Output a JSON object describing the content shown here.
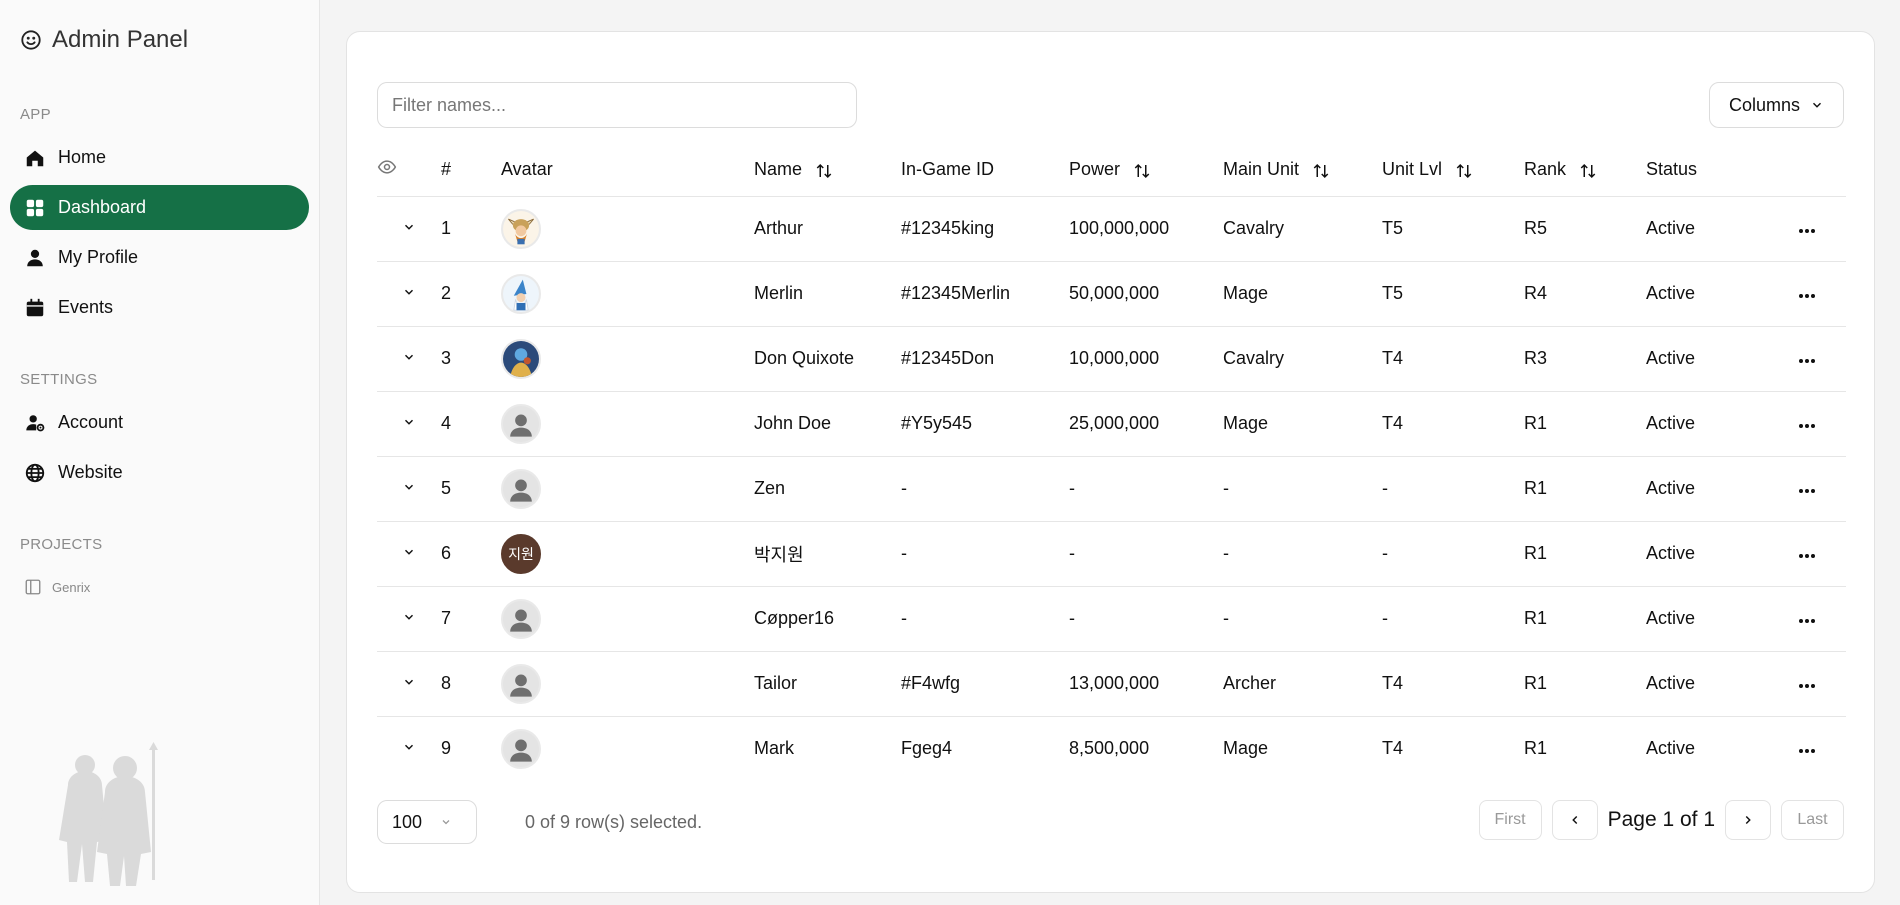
{
  "app": {
    "title": "Admin Panel"
  },
  "sidebar": {
    "sections": [
      {
        "label": "APP"
      },
      {
        "label": "SETTINGS"
      },
      {
        "label": "PROJECTS"
      }
    ],
    "items": [
      {
        "label": "Home",
        "icon": "home-icon"
      },
      {
        "label": "Dashboard",
        "icon": "dashboard-icon",
        "active": true
      },
      {
        "label": "My Profile",
        "icon": "user-icon"
      },
      {
        "label": "Events",
        "icon": "calendar-icon"
      },
      {
        "label": "Account",
        "icon": "user-gear-icon"
      },
      {
        "label": "Website",
        "icon": "globe-icon"
      }
    ],
    "projects": [
      {
        "label": "Genrix",
        "icon": "panel-icon"
      }
    ]
  },
  "toolbar": {
    "filter_placeholder": "Filter names...",
    "columns_label": "Columns"
  },
  "table": {
    "headers": {
      "num": "#",
      "avatar": "Avatar",
      "name": "Name",
      "ingame_id": "In-Game ID",
      "power": "Power",
      "main_unit": "Main Unit",
      "unit_lvl": "Unit Lvl",
      "rank": "Rank",
      "status": "Status"
    },
    "rows": [
      {
        "num": "1",
        "avatar": "viking-avatar",
        "name": "Arthur",
        "ingame_id": "#12345king",
        "power": "100,000,000",
        "main_unit": "Cavalry",
        "unit_lvl": "T5",
        "rank": "R5",
        "status": "Active"
      },
      {
        "num": "2",
        "avatar": "wizard-avatar",
        "name": "Merlin",
        "ingame_id": "#12345Merlin",
        "power": "50,000,000",
        "main_unit": "Mage",
        "unit_lvl": "T5",
        "rank": "R4",
        "status": "Active"
      },
      {
        "num": "3",
        "avatar": "knight-avatar",
        "name": "Don Quixote",
        "ingame_id": "#12345Don",
        "power": "10,000,000",
        "main_unit": "Cavalry",
        "unit_lvl": "T4",
        "rank": "R3",
        "status": "Active"
      },
      {
        "num": "4",
        "avatar": "default-avatar",
        "name": "John Doe",
        "ingame_id": "#Y5y545",
        "power": "25,000,000",
        "main_unit": "Mage",
        "unit_lvl": "T4",
        "rank": "R1",
        "status": "Active"
      },
      {
        "num": "5",
        "avatar": "default-avatar",
        "name": "Zen",
        "ingame_id": "-",
        "power": "-",
        "main_unit": "-",
        "unit_lvl": "-",
        "rank": "R1",
        "status": "Active"
      },
      {
        "num": "6",
        "avatar": "initials-avatar",
        "avatar_text": "지원",
        "name": "박지원",
        "ingame_id": "-",
        "power": "-",
        "main_unit": "-",
        "unit_lvl": "-",
        "rank": "R1",
        "status": "Active"
      },
      {
        "num": "7",
        "avatar": "default-avatar",
        "name": "Cøpper16",
        "ingame_id": "-",
        "power": "-",
        "main_unit": "-",
        "unit_lvl": "-",
        "rank": "R1",
        "status": "Active"
      },
      {
        "num": "8",
        "avatar": "default-avatar",
        "name": "Tailor",
        "ingame_id": "#F4wfg",
        "power": "13,000,000",
        "main_unit": "Archer",
        "unit_lvl": "T4",
        "rank": "R1",
        "status": "Active"
      },
      {
        "num": "9",
        "avatar": "default-avatar",
        "name": "Mark",
        "ingame_id": "Fgeg4",
        "power": "8,500,000",
        "main_unit": "Mage",
        "unit_lvl": "T4",
        "rank": "R1",
        "status": "Active"
      }
    ]
  },
  "footer": {
    "page_size": "100",
    "selection": "0 of 9 row(s) selected.",
    "first": "First",
    "last": "Last",
    "page_text": "Page 1 of 1"
  },
  "colors": {
    "accent": "#157046"
  }
}
